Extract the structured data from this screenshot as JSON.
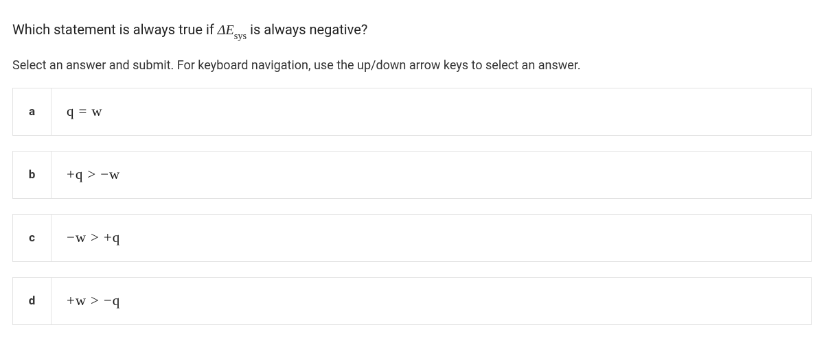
{
  "question": {
    "prefix": "Which statement is always true if ",
    "symbol_delta": "Δ",
    "symbol_var": "E",
    "symbol_sub": "sys",
    "suffix": " is always negative?"
  },
  "instructions": "Select an answer and submit. For keyboard navigation, use the up/down arrow keys to select an answer.",
  "options": [
    {
      "letter": "a",
      "lhs": "q",
      "op": "=",
      "rhs": "w"
    },
    {
      "letter": "b",
      "lhs": "+q",
      "op": ">",
      "rhs": "−w"
    },
    {
      "letter": "c",
      "lhs": "−w",
      "op": ">",
      "rhs": "+q"
    },
    {
      "letter": "d",
      "lhs": "+w",
      "op": ">",
      "rhs": "−q"
    }
  ]
}
